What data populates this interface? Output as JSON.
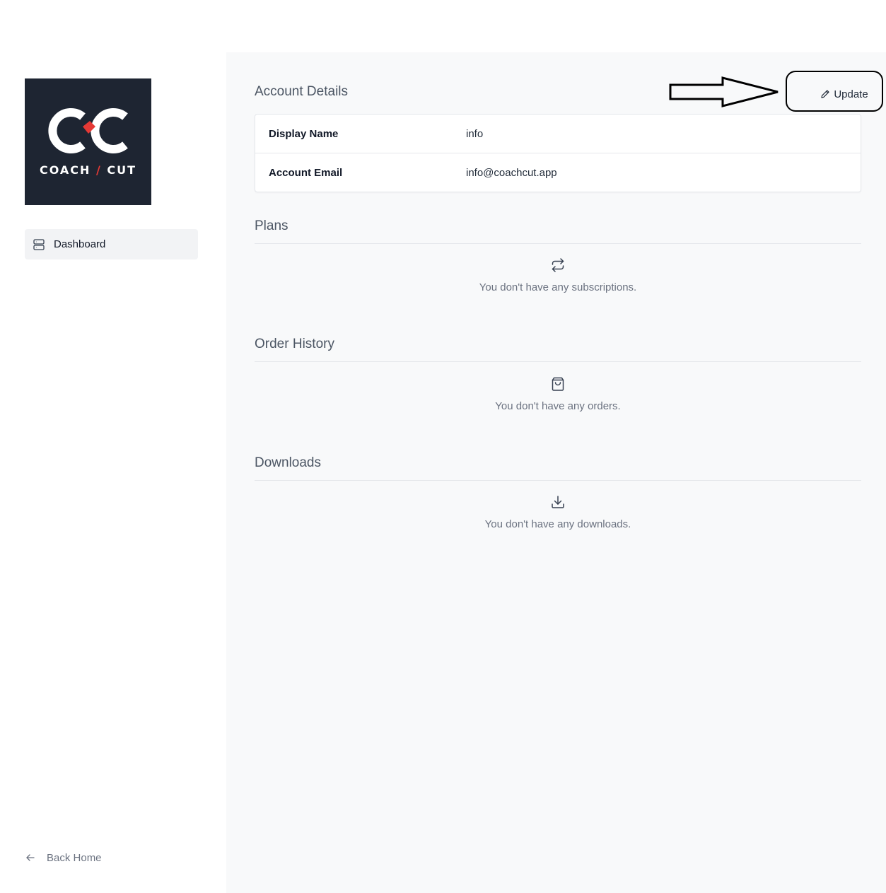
{
  "sidebar": {
    "logo": {
      "text_left": "COACH",
      "text_right": "CUT",
      "brand_bg": "#1e2532",
      "accent": "#e53935"
    },
    "nav": [
      {
        "label": "Dashboard",
        "icon": "server-icon",
        "active": true
      }
    ],
    "back_home": {
      "label": "Back Home",
      "icon": "arrow-left-icon"
    }
  },
  "main": {
    "account_details": {
      "title": "Account Details",
      "update_label": "Update",
      "rows": [
        {
          "label": "Display Name",
          "value": "info"
        },
        {
          "label": "Account Email",
          "value": "info@coachcut.app"
        }
      ]
    },
    "plans": {
      "title": "Plans",
      "empty_message": "You don't have any subscriptions.",
      "icon": "repeat-icon"
    },
    "orders": {
      "title": "Order History",
      "empty_message": "You don't have any orders.",
      "icon": "shopping-bag-icon"
    },
    "downloads": {
      "title": "Downloads",
      "empty_message": "You don't have any downloads.",
      "icon": "download-icon"
    }
  }
}
